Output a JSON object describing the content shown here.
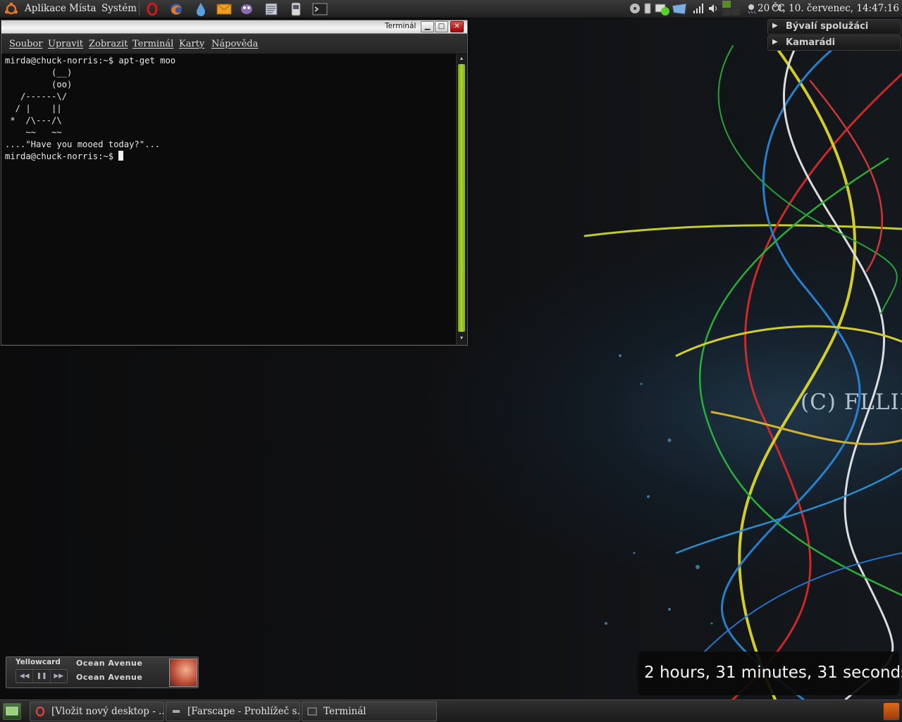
{
  "top_panel": {
    "menus": [
      "Aplikace",
      "Místa",
      "Systém"
    ],
    "launchers": [
      "opera-icon",
      "firefox-icon",
      "water-drop-icon",
      "mail-icon",
      "pidgin-icon",
      "notes-icon",
      "device-icon",
      "terminal-icon"
    ],
    "weather": "20 °C",
    "clock": "Čt, 10. červenec, 14:47:16"
  },
  "terminal": {
    "window_title": "Terminál",
    "menus": [
      "Soubor",
      "Upravit",
      "Zobrazit",
      "Terminál",
      "Karty",
      "Nápověda"
    ],
    "lines": [
      "mirda@chuck-norris:~$ apt-get moo",
      "         (__)",
      "         (oo)",
      "   /------\\/",
      "  / |    ||",
      " *  /\\---/\\",
      "    ~~   ~~",
      "....\"Have you mooed today?\"...",
      "mirda@chuck-norris:~$ "
    ]
  },
  "buddy_list": {
    "groups": [
      "Bývalí spolužáci",
      "Kamarádi"
    ]
  },
  "wallpaper": {
    "copyright": "(C) FLLINT"
  },
  "player": {
    "artist": "Yellowcard",
    "title": "Ocean Avenue",
    "album": "Ocean Avenue",
    "controls": [
      "previous-icon",
      "pause-icon",
      "next-icon"
    ]
  },
  "uptime": {
    "text": "2 hours, 31 minutes, 31 seconds"
  },
  "taskbar": {
    "tasks": [
      {
        "label": "[Vložit nový desktop - ...",
        "icon": "opera-icon"
      },
      {
        "label": "[Farscape - Prohlížeč s...",
        "icon": "viewer-icon"
      },
      {
        "label": "Terminál",
        "icon": "terminal-icon"
      }
    ]
  },
  "colors": {
    "scrollbar": "#a6d430",
    "close_button": "#c81818"
  }
}
